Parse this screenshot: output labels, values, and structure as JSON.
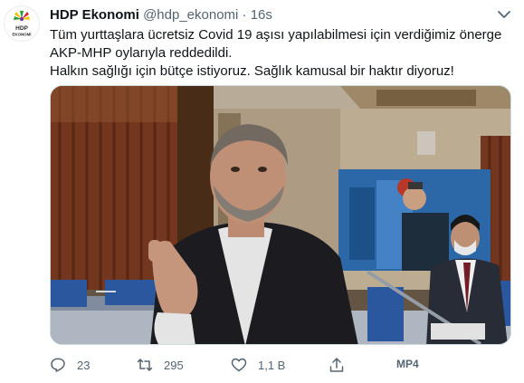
{
  "author": {
    "name": "HDP Ekonomi",
    "handle": "@hdp_ekonomi",
    "separator": "·",
    "time": "16s",
    "avatar_text_top": "HDP",
    "avatar_text_bottom": "EKONOMİ"
  },
  "tweet": {
    "line1": "Tüm yurttaşlara ücretsiz Covid 19 aşısı yapılabilmesi için verdiğimiz önerge AKP-MHP oylarıyla reddedildi.",
    "line2": "Halkın sağlığı için bütçe istiyoruz. Sağlık kamusal bir haktır diyoruz!"
  },
  "media": {
    "type": "video",
    "badge": "MP4"
  },
  "actions": {
    "replies": "23",
    "retweets": "295",
    "likes": "1,1 B"
  },
  "icons": {
    "menu": "chevron-down-icon",
    "reply": "reply-icon",
    "retweet": "retweet-icon",
    "like": "heart-icon",
    "share": "share-icon"
  },
  "colors": {
    "text": "#0f1419",
    "muted": "#536471",
    "logo_green": "#2e9b3a",
    "logo_yellow": "#f2c200",
    "logo_red": "#d7262f"
  }
}
